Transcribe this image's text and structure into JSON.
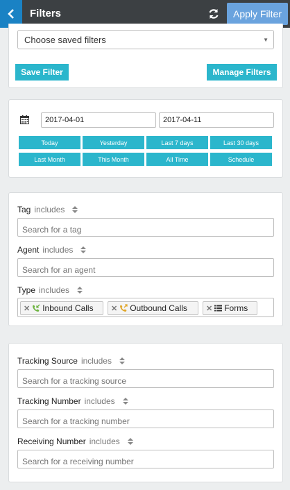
{
  "header": {
    "title": "Filters",
    "apply_label": "Apply Filter",
    "back_icon": "chevron-left-icon",
    "refresh_icon": "refresh-icon"
  },
  "saved_filters": {
    "select_value": "Choose saved filters",
    "save_label": "Save Filter",
    "manage_label": "Manage Filters"
  },
  "date_range": {
    "start": "2017-04-01",
    "end": "2017-04-11",
    "presets": [
      "Today",
      "Yesterday",
      "Last 7 days",
      "Last 30 days",
      "Last Month",
      "This Month",
      "All Time",
      "Schedule"
    ]
  },
  "filters1": {
    "tag": {
      "label": "Tag",
      "op": "includes",
      "placeholder": "Search for a tag"
    },
    "agent": {
      "label": "Agent",
      "op": "includes",
      "placeholder": "Search for an agent"
    },
    "type": {
      "label": "Type",
      "op": "includes",
      "tags": [
        {
          "label": "Inbound Calls",
          "icon": "inbound-call-icon"
        },
        {
          "label": "Outbound Calls",
          "icon": "outbound-call-icon"
        },
        {
          "label": "Forms",
          "icon": "list-icon"
        }
      ]
    }
  },
  "filters2": {
    "tracking_source": {
      "label": "Tracking Source",
      "op": "includes",
      "placeholder": "Search for a tracking source"
    },
    "tracking_number": {
      "label": "Tracking Number",
      "op": "includes",
      "placeholder": "Search for a tracking number"
    },
    "receiving_number": {
      "label": "Receiving Number",
      "op": "includes",
      "placeholder": "Search for a receiving number"
    }
  },
  "colors": {
    "header_bg": "#3c4043",
    "back_button": "#1a82c4",
    "apply_button": "#6aa3de",
    "teal_button": "#2bb6cc",
    "inbound_icon": "#6cb33f",
    "outbound_icon": "#e0a526"
  }
}
